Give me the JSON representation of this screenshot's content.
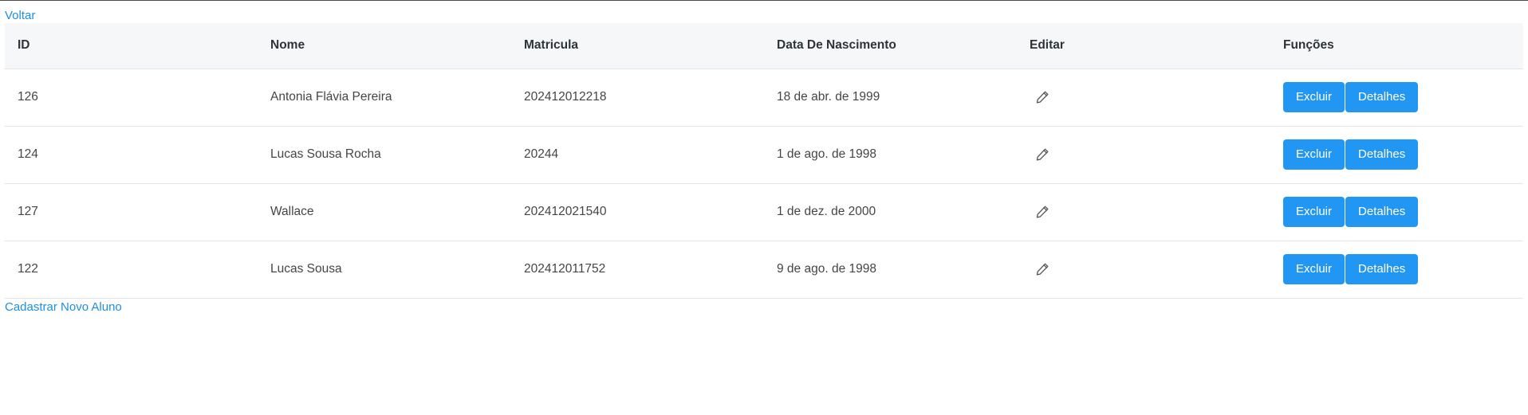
{
  "nav": {
    "back_label": "Voltar",
    "new_label": "Cadastrar Novo Aluno"
  },
  "table": {
    "headers": {
      "id": "ID",
      "nome": "Nome",
      "matricula": "Matricula",
      "data": "Data De Nascimento",
      "editar": "Editar",
      "funcoes": "Funções"
    },
    "rows": [
      {
        "id": "126",
        "nome": "Antonia Flávia Pereira",
        "matricula": "202412012218",
        "data": "18 de abr. de 1999"
      },
      {
        "id": "124",
        "nome": "Lucas Sousa Rocha",
        "matricula": "20244",
        "data": "1 de ago. de 1998"
      },
      {
        "id": "127",
        "nome": "Wallace",
        "matricula": "202412021540",
        "data": "1 de dez. de 2000"
      },
      {
        "id": "122",
        "nome": "Lucas Sousa",
        "matricula": "202412011752",
        "data": "9 de ago. de 1998"
      }
    ],
    "actions": {
      "delete_label": "Excluir",
      "details_label": "Detalhes",
      "edit_icon": "pencil-icon"
    }
  },
  "colors": {
    "link": "#1d8fe0",
    "button": "#2196f3",
    "header_bg": "#f6f7f9"
  }
}
